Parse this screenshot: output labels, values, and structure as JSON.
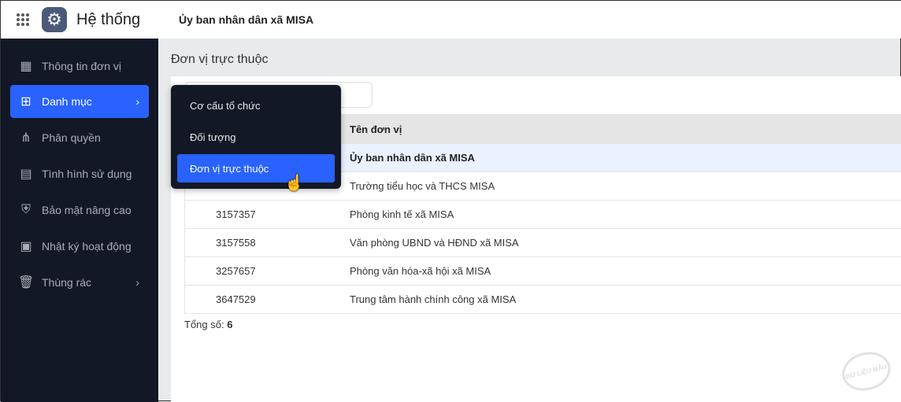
{
  "header": {
    "app_title": "Hệ thống",
    "org_name": "Ủy ban nhân dân xã MISA"
  },
  "sidebar": {
    "items": [
      {
        "label": "Thông tin đơn vị",
        "icon": "building-icon"
      },
      {
        "label": "Danh mục",
        "icon": "grid-icon",
        "active": true
      },
      {
        "label": "Phân quyền",
        "icon": "hierarchy-icon"
      },
      {
        "label": "Tình hình sử dụng",
        "icon": "report-icon"
      },
      {
        "label": "Bảo mật nâng cao",
        "icon": "shield-icon"
      },
      {
        "label": "Nhật ký hoạt động",
        "icon": "clipboard-clock-icon"
      },
      {
        "label": "Thùng rác",
        "icon": "trash-icon"
      }
    ]
  },
  "page": {
    "title": "Đơn vị trực thuộc"
  },
  "dropdown": {
    "items": [
      "Cơ cấu tổ chức",
      "Đối tượng",
      "Đơn vị trực thuộc"
    ]
  },
  "table": {
    "header_name": "Tên đơn vị",
    "rows": [
      {
        "code": "",
        "name": "Ủy ban nhân dân xã MISA"
      },
      {
        "code": "",
        "name": "Trường tiểu học và THCS MISA"
      },
      {
        "code": "3157357",
        "name": "Phòng kinh tế xã MISA"
      },
      {
        "code": "3157558",
        "name": "Văn phòng UBND và HĐND xã MISA"
      },
      {
        "code": "3257657",
        "name": "Phòng văn hóa-xã hội xã MISA"
      },
      {
        "code": "3647529",
        "name": "Trung tâm hành chính công xã MISA"
      }
    ]
  },
  "footer": {
    "total_label": "Tổng số:",
    "total_value": "6"
  },
  "watermark": "DỮ LIỆU MẪU",
  "colors": {
    "accent": "#2962ff",
    "sidebar": "#121826"
  }
}
